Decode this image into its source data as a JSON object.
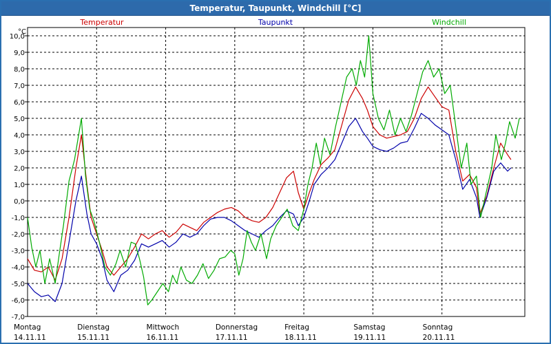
{
  "window": {
    "title": "Temperatur, Taupunkt, Windchill [°C]"
  },
  "chart_data": {
    "type": "line",
    "title": "Temperatur, Taupunkt, Windchill [°C]",
    "ylabel": "°C",
    "ylim": [
      -7,
      10.5
    ],
    "yticks": [
      "10,0",
      "9,0",
      "8,0",
      "7,0",
      "6,0",
      "5,0",
      "4,0",
      "3,0",
      "2,0",
      "1,0",
      "0,0",
      "-1,0",
      "-2,0",
      "-3,0",
      "-4,0",
      "-5,0",
      "-6,0",
      "-7,0"
    ],
    "xlim": [
      0,
      7
    ],
    "x_categories": [
      {
        "day": "Montag",
        "date": "14.11.11"
      },
      {
        "day": "Dienstag",
        "date": "15.11.11"
      },
      {
        "day": "Mittwoch",
        "date": "16.11.11"
      },
      {
        "day": "Donnerstag",
        "date": "17.11.11"
      },
      {
        "day": "Freitag",
        "date": "18.11.11"
      },
      {
        "day": "Samstag",
        "date": "19.11.11"
      },
      {
        "day": "Sonntag",
        "date": "20.11.11"
      }
    ],
    "grid": true,
    "legend": "top",
    "series": [
      {
        "name": "Temperatur",
        "color": "#cc0000",
        "points": [
          [
            0.0,
            -3.5
          ],
          [
            0.1,
            -4.2
          ],
          [
            0.2,
            -4.3
          ],
          [
            0.3,
            -4.0
          ],
          [
            0.4,
            -4.8
          ],
          [
            0.5,
            -3.5
          ],
          [
            0.6,
            -1.0
          ],
          [
            0.7,
            2.0
          ],
          [
            0.78,
            4.0
          ],
          [
            0.86,
            1.0
          ],
          [
            0.92,
            -1.0
          ],
          [
            1.0,
            -2.0
          ],
          [
            1.08,
            -3.0
          ],
          [
            1.15,
            -4.0
          ],
          [
            1.25,
            -4.5
          ],
          [
            1.35,
            -4.0
          ],
          [
            1.45,
            -3.5
          ],
          [
            1.55,
            -2.8
          ],
          [
            1.65,
            -2.0
          ],
          [
            1.75,
            -2.3
          ],
          [
            1.85,
            -2.0
          ],
          [
            1.95,
            -1.8
          ],
          [
            2.05,
            -2.2
          ],
          [
            2.15,
            -1.9
          ],
          [
            2.25,
            -1.4
          ],
          [
            2.35,
            -1.6
          ],
          [
            2.45,
            -1.8
          ],
          [
            2.55,
            -1.3
          ],
          [
            2.65,
            -1.0
          ],
          [
            2.75,
            -0.7
          ],
          [
            2.85,
            -0.5
          ],
          [
            2.95,
            -0.4
          ],
          [
            3.05,
            -0.6
          ],
          [
            3.15,
            -1.0
          ],
          [
            3.25,
            -1.2
          ],
          [
            3.35,
            -1.3
          ],
          [
            3.45,
            -1.0
          ],
          [
            3.55,
            -0.4
          ],
          [
            3.65,
            0.5
          ],
          [
            3.75,
            1.4
          ],
          [
            3.85,
            1.8
          ],
          [
            3.92,
            0.5
          ],
          [
            4.0,
            -0.5
          ],
          [
            4.08,
            0.5
          ],
          [
            4.15,
            1.3
          ],
          [
            4.25,
            2.2
          ],
          [
            4.35,
            2.6
          ],
          [
            4.45,
            3.1
          ],
          [
            4.55,
            4.6
          ],
          [
            4.65,
            6.1
          ],
          [
            4.75,
            6.9
          ],
          [
            4.85,
            6.2
          ],
          [
            4.92,
            5.5
          ],
          [
            5.0,
            4.5
          ],
          [
            5.1,
            4.0
          ],
          [
            5.2,
            3.8
          ],
          [
            5.3,
            3.9
          ],
          [
            5.4,
            4.0
          ],
          [
            5.5,
            4.2
          ],
          [
            5.6,
            5.0
          ],
          [
            5.7,
            6.2
          ],
          [
            5.8,
            6.9
          ],
          [
            5.9,
            6.3
          ],
          [
            6.0,
            5.7
          ],
          [
            6.1,
            5.5
          ],
          [
            6.2,
            3.0
          ],
          [
            6.3,
            1.2
          ],
          [
            6.4,
            1.6
          ],
          [
            6.5,
            0.8
          ],
          [
            6.55,
            -0.8
          ],
          [
            6.65,
            0.3
          ],
          [
            6.75,
            2.0
          ],
          [
            6.85,
            3.5
          ],
          [
            6.95,
            2.8
          ],
          [
            7.0,
            2.5
          ]
        ]
      },
      {
        "name": "Taupunkt",
        "color": "#0000aa",
        "points": [
          [
            0.0,
            -5.0
          ],
          [
            0.1,
            -5.5
          ],
          [
            0.2,
            -5.8
          ],
          [
            0.3,
            -5.7
          ],
          [
            0.4,
            -6.1
          ],
          [
            0.5,
            -5.0
          ],
          [
            0.6,
            -2.5
          ],
          [
            0.7,
            0.0
          ],
          [
            0.78,
            1.5
          ],
          [
            0.86,
            -0.8
          ],
          [
            0.92,
            -2.0
          ],
          [
            1.0,
            -2.6
          ],
          [
            1.08,
            -3.5
          ],
          [
            1.15,
            -4.8
          ],
          [
            1.25,
            -5.5
          ],
          [
            1.35,
            -4.5
          ],
          [
            1.45,
            -4.2
          ],
          [
            1.55,
            -3.6
          ],
          [
            1.65,
            -2.6
          ],
          [
            1.75,
            -2.8
          ],
          [
            1.85,
            -2.6
          ],
          [
            1.95,
            -2.4
          ],
          [
            2.05,
            -2.8
          ],
          [
            2.15,
            -2.5
          ],
          [
            2.25,
            -2.0
          ],
          [
            2.35,
            -2.2
          ],
          [
            2.45,
            -2.0
          ],
          [
            2.55,
            -1.5
          ],
          [
            2.65,
            -1.1
          ],
          [
            2.75,
            -1.0
          ],
          [
            2.85,
            -1.0
          ],
          [
            2.95,
            -1.2
          ],
          [
            3.05,
            -1.5
          ],
          [
            3.15,
            -1.8
          ],
          [
            3.25,
            -2.0
          ],
          [
            3.35,
            -2.2
          ],
          [
            3.45,
            -1.8
          ],
          [
            3.55,
            -1.5
          ],
          [
            3.65,
            -1.0
          ],
          [
            3.75,
            -0.6
          ],
          [
            3.85,
            -0.8
          ],
          [
            3.92,
            -1.5
          ],
          [
            4.0,
            -1.0
          ],
          [
            4.08,
            0.0
          ],
          [
            4.15,
            1.0
          ],
          [
            4.25,
            1.6
          ],
          [
            4.35,
            2.0
          ],
          [
            4.45,
            2.5
          ],
          [
            4.55,
            3.5
          ],
          [
            4.65,
            4.5
          ],
          [
            4.75,
            5.0
          ],
          [
            4.85,
            4.2
          ],
          [
            4.92,
            3.8
          ],
          [
            5.0,
            3.3
          ],
          [
            5.1,
            3.1
          ],
          [
            5.2,
            3.0
          ],
          [
            5.3,
            3.2
          ],
          [
            5.4,
            3.5
          ],
          [
            5.5,
            3.6
          ],
          [
            5.6,
            4.4
          ],
          [
            5.7,
            5.3
          ],
          [
            5.8,
            5.0
          ],
          [
            5.9,
            4.6
          ],
          [
            6.0,
            4.3
          ],
          [
            6.1,
            4.0
          ],
          [
            6.2,
            2.5
          ],
          [
            6.3,
            0.7
          ],
          [
            6.4,
            1.3
          ],
          [
            6.5,
            0.2
          ],
          [
            6.55,
            -1.0
          ],
          [
            6.65,
            0.2
          ],
          [
            6.75,
            1.8
          ],
          [
            6.85,
            2.3
          ],
          [
            6.95,
            1.8
          ],
          [
            7.0,
            2.0
          ]
        ]
      },
      {
        "name": "Windchill",
        "color": "#00aa00",
        "points": [
          [
            0.0,
            -1.0
          ],
          [
            0.06,
            -2.8
          ],
          [
            0.12,
            -4.0
          ],
          [
            0.18,
            -3.0
          ],
          [
            0.25,
            -5.0
          ],
          [
            0.32,
            -3.5
          ],
          [
            0.4,
            -5.0
          ],
          [
            0.46,
            -3.2
          ],
          [
            0.52,
            -1.5
          ],
          [
            0.6,
            1.2
          ],
          [
            0.68,
            2.5
          ],
          [
            0.78,
            5.0
          ],
          [
            0.84,
            1.5
          ],
          [
            0.9,
            -0.5
          ],
          [
            0.96,
            -1.2
          ],
          [
            1.04,
            -2.5
          ],
          [
            1.12,
            -4.0
          ],
          [
            1.2,
            -4.5
          ],
          [
            1.28,
            -3.8
          ],
          [
            1.34,
            -3.0
          ],
          [
            1.42,
            -4.0
          ],
          [
            1.5,
            -2.5
          ],
          [
            1.56,
            -2.6
          ],
          [
            1.62,
            -3.5
          ],
          [
            1.68,
            -4.6
          ],
          [
            1.74,
            -6.3
          ],
          [
            1.8,
            -6.0
          ],
          [
            1.88,
            -5.5
          ],
          [
            1.96,
            -5.0
          ],
          [
            2.04,
            -5.5
          ],
          [
            2.1,
            -4.5
          ],
          [
            2.16,
            -5.0
          ],
          [
            2.22,
            -4.0
          ],
          [
            2.3,
            -4.8
          ],
          [
            2.38,
            -5.0
          ],
          [
            2.46,
            -4.5
          ],
          [
            2.54,
            -3.8
          ],
          [
            2.62,
            -4.7
          ],
          [
            2.7,
            -4.2
          ],
          [
            2.78,
            -3.5
          ],
          [
            2.86,
            -3.4
          ],
          [
            2.94,
            -3.0
          ],
          [
            3.0,
            -3.2
          ],
          [
            3.06,
            -4.5
          ],
          [
            3.12,
            -3.5
          ],
          [
            3.18,
            -1.8
          ],
          [
            3.24,
            -2.5
          ],
          [
            3.3,
            -3.0
          ],
          [
            3.38,
            -2.0
          ],
          [
            3.46,
            -3.5
          ],
          [
            3.52,
            -2.3
          ],
          [
            3.6,
            -1.5
          ],
          [
            3.68,
            -1.0
          ],
          [
            3.76,
            -0.5
          ],
          [
            3.84,
            -1.5
          ],
          [
            3.92,
            -1.8
          ],
          [
            4.0,
            -0.5
          ],
          [
            4.06,
            1.0
          ],
          [
            4.12,
            2.0
          ],
          [
            4.18,
            3.5
          ],
          [
            4.24,
            2.2
          ],
          [
            4.3,
            3.8
          ],
          [
            4.38,
            2.8
          ],
          [
            4.46,
            4.5
          ],
          [
            4.54,
            6.0
          ],
          [
            4.62,
            7.5
          ],
          [
            4.7,
            8.0
          ],
          [
            4.76,
            7.0
          ],
          [
            4.82,
            8.5
          ],
          [
            4.88,
            7.5
          ],
          [
            4.94,
            10.0
          ],
          [
            5.0,
            6.5
          ],
          [
            5.08,
            5.0
          ],
          [
            5.16,
            4.3
          ],
          [
            5.24,
            5.5
          ],
          [
            5.32,
            4.0
          ],
          [
            5.4,
            5.0
          ],
          [
            5.48,
            4.2
          ],
          [
            5.56,
            5.2
          ],
          [
            5.64,
            6.5
          ],
          [
            5.72,
            7.8
          ],
          [
            5.8,
            8.5
          ],
          [
            5.88,
            7.5
          ],
          [
            5.96,
            8.0
          ],
          [
            6.04,
            6.5
          ],
          [
            6.12,
            7.0
          ],
          [
            6.2,
            4.5
          ],
          [
            6.28,
            2.0
          ],
          [
            6.36,
            3.5
          ],
          [
            6.42,
            1.0
          ],
          [
            6.5,
            1.5
          ],
          [
            6.56,
            -1.0
          ],
          [
            6.64,
            0.5
          ],
          [
            6.72,
            2.0
          ],
          [
            6.78,
            4.0
          ],
          [
            6.86,
            2.5
          ],
          [
            6.92,
            3.5
          ],
          [
            6.98,
            4.8
          ],
          [
            7.06,
            3.8
          ],
          [
            7.12,
            5.0
          ]
        ]
      }
    ]
  }
}
